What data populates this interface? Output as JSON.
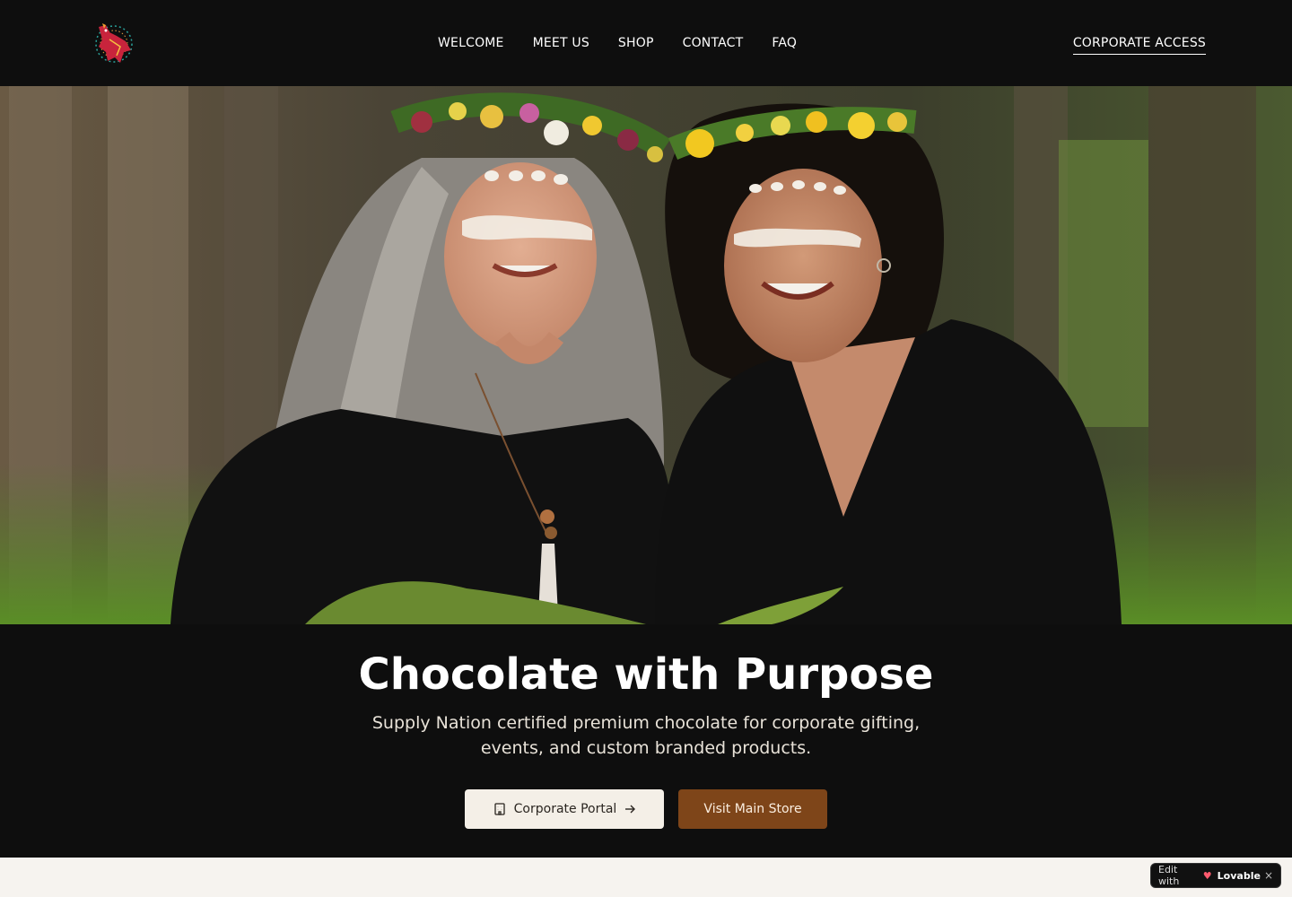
{
  "header": {
    "nav": [
      {
        "label": "WELCOME"
      },
      {
        "label": "MEET US"
      },
      {
        "label": "SHOP"
      },
      {
        "label": "CONTACT"
      },
      {
        "label": "FAQ"
      }
    ],
    "corporate_access": "CORPORATE ACCESS",
    "logo_icon": "cockatoo-logo-icon"
  },
  "hero": {
    "image_icon": "hero-photo"
  },
  "main": {
    "title": "Chocolate with Purpose",
    "subtitle": "Supply Nation certified premium chocolate for corporate gifting, events, and custom branded products.",
    "portal_button": "Corporate Portal",
    "store_button": "Visit Main Store"
  },
  "badge": {
    "prefix": "Edit with",
    "brand": "Lovable",
    "close": "×"
  },
  "colors": {
    "background": "#0e0e0e",
    "store_button": "#7e4519",
    "portal_button": "#f4efe7"
  }
}
